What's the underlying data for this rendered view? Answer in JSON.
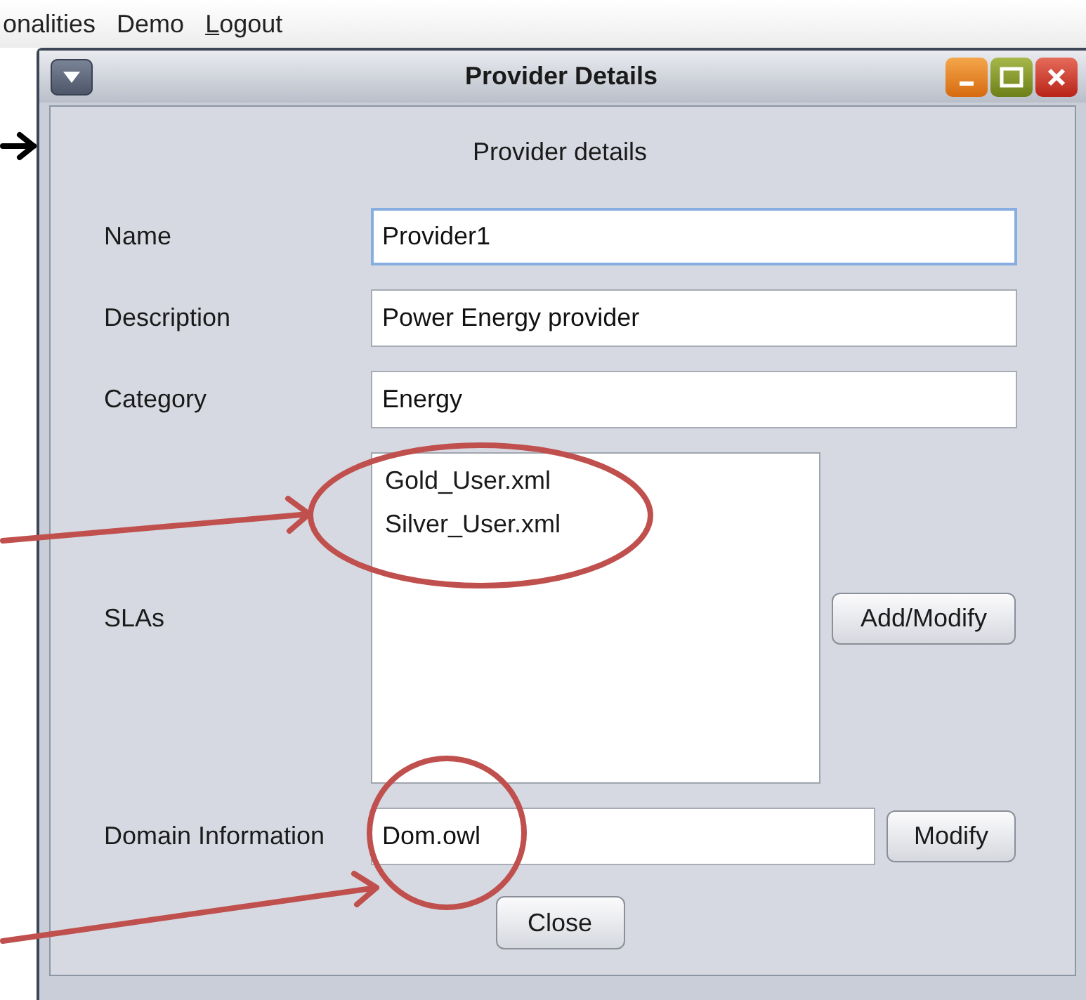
{
  "menu": [
    {
      "label": "onalities",
      "underline_first": false
    },
    {
      "label": "Demo",
      "underline_first": false
    },
    {
      "label": "Logout",
      "underline_first": true
    }
  ],
  "window": {
    "title": "Provider Details"
  },
  "heading": "Provider details",
  "fields": [
    {
      "label": "Name",
      "value": "Provider1",
      "focused": true
    },
    {
      "label": "Description",
      "value": "Power Energy provider",
      "focused": false
    },
    {
      "label": "Category",
      "value": "Energy",
      "focused": false
    }
  ],
  "slas": {
    "label": "SLAs",
    "items": [
      {
        "text": "Gold_User.xml",
        "selected": false
      },
      {
        "text": "Silver_User.xml",
        "selected": false
      }
    ],
    "button": "Add/Modify"
  },
  "domain": {
    "label": "Domain Information",
    "value": "Dom.owl",
    "button": "Modify"
  },
  "close_button": "Close"
}
